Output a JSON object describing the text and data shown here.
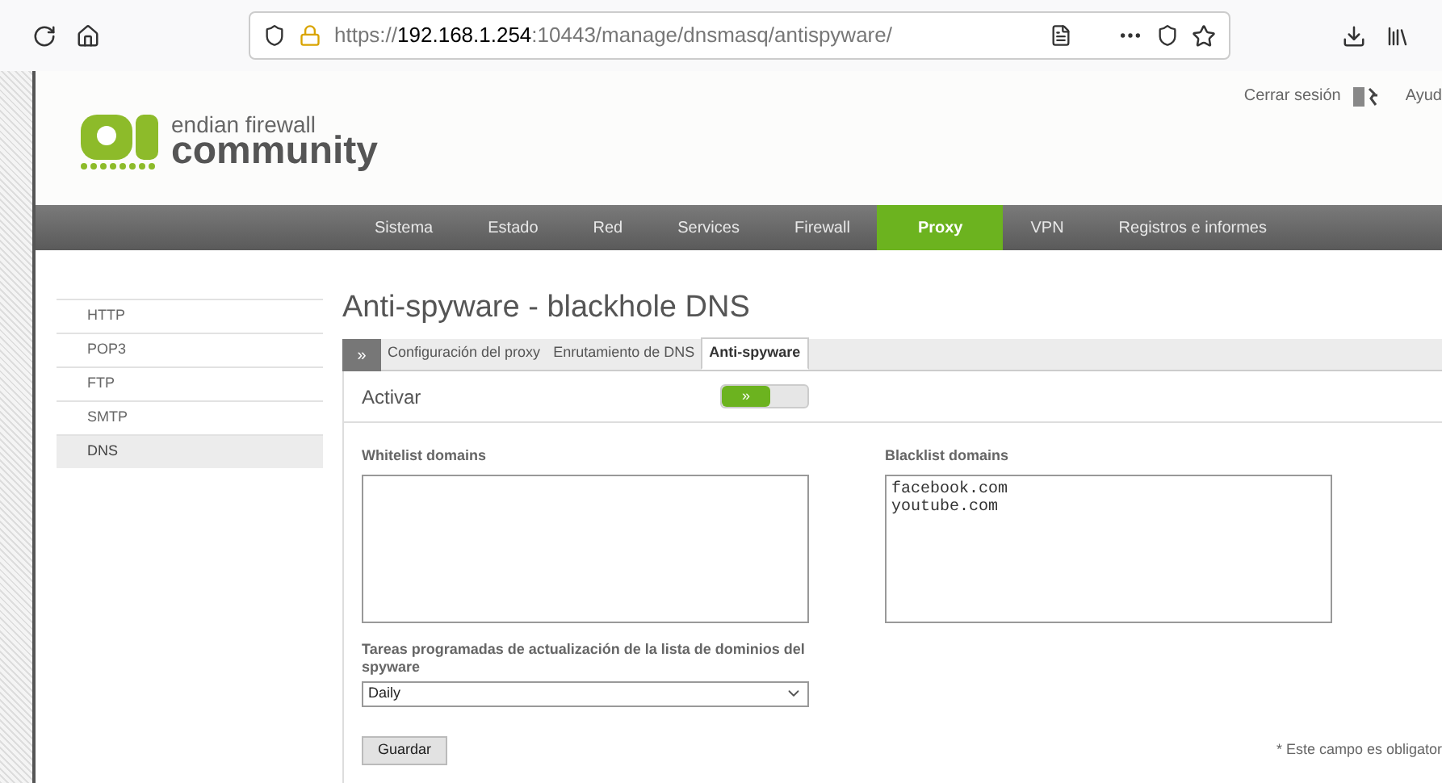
{
  "browser": {
    "url": "https://**192.168.1.254**:10443/manage/dnsmasq/antispyware/"
  },
  "header": {
    "logo_line1": "endian firewall",
    "logo_line2": "community",
    "logout": "Cerrar sesión",
    "help": "Ayud"
  },
  "nav": [
    {
      "label": "Sistema",
      "selected": false
    },
    {
      "label": "Estado",
      "selected": false
    },
    {
      "label": "Red",
      "selected": false
    },
    {
      "label": "Services",
      "selected": false
    },
    {
      "label": "Firewall",
      "selected": false
    },
    {
      "label": "Proxy",
      "selected": true
    },
    {
      "label": "VPN",
      "selected": false
    },
    {
      "label": "Registros e informes",
      "selected": false
    }
  ],
  "sidebar": {
    "items": [
      {
        "label": "HTTP",
        "selected": false
      },
      {
        "label": "POP3",
        "selected": false
      },
      {
        "label": "FTP",
        "selected": false
      },
      {
        "label": "SMTP",
        "selected": false
      },
      {
        "label": "DNS",
        "selected": true
      }
    ]
  },
  "title": "Anti-spyware - blackhole DNS",
  "tabs": {
    "expander": "»",
    "items": [
      {
        "label": "Configuración del proxy",
        "selected": false
      },
      {
        "label": "Enrutamiento de DNS",
        "selected": false
      },
      {
        "label": "Anti-spyware",
        "selected": true
      }
    ]
  },
  "activate": {
    "label": "Activar",
    "on": true,
    "knob": "»"
  },
  "whitelist": {
    "label": "Whitelist domains"
  },
  "blacklist": {
    "label": "Blacklist domains",
    "value": "facebook.com\nyoutube.com"
  },
  "schedule": {
    "label": "Tareas programadas de actualización de la lista de dominios del spyware",
    "value": "Daily"
  },
  "save_button": "Guardar",
  "required_note": "* Este campo es obligator"
}
